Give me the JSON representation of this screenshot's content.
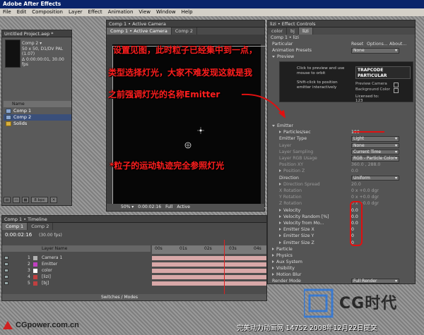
{
  "window": {
    "title": "Adobe After Effects"
  },
  "menu": [
    "File",
    "Edit",
    "Composition",
    "Layer",
    "Effect",
    "Animation",
    "View",
    "Window",
    "Help"
  ],
  "project": {
    "title": "Untitled Project.aep *",
    "thumb_name": "Comp 2 ▾",
    "info": [
      "50 x 50, D1/DV PAL (1.07)",
      "Δ 0:00:00:01, 30.00 fps"
    ],
    "col_name": "Name",
    "items": [
      {
        "name": "Comp 1",
        "type": "comp"
      },
      {
        "name": "Comp 2",
        "type": "comp"
      },
      {
        "name": "Solids",
        "type": "folder"
      }
    ],
    "bpc": "8 bpc"
  },
  "viewer": {
    "title": "Comp 1 • Active Camera",
    "tabs": [
      "Comp 1 • Active Camera",
      "Comp 2"
    ],
    "zoom": "50% ▾",
    "time": "0:00:02:16",
    "res": "Full",
    "view": "Active"
  },
  "effects": {
    "title": "lizi • Effect Controls",
    "tabs": [
      "color",
      "bj",
      "lizi"
    ],
    "breadcrumb": "Comp 1 • lizi",
    "effect_name": "Particular",
    "reset": "Reset",
    "options": "Options...",
    "about": "About...",
    "presets_label": "Animation Presets",
    "presets_value": "None",
    "preview_label": "Preview",
    "preview_hint1": "Click to preview and use mouse to orbit",
    "preview_hint2": "Shift-click to position emitter interactively",
    "logo": "TRAPCODE PARTICULAR",
    "preview_camera": "Preview Camera",
    "background_color": "Background Color",
    "licensed_to": "Licensed to:",
    "license_num": "123",
    "rows": [
      {
        "label": "Emitter",
        "value": "",
        "indent": 0,
        "tri": "open",
        "dim": false
      },
      {
        "label": "Particles/sec",
        "value": "100",
        "indent": 1,
        "tri": "closed",
        "dim": false
      },
      {
        "label": "Emitter Type",
        "value": "Light",
        "indent": 1,
        "tri": "",
        "dim": false,
        "dropdown": true
      },
      {
        "label": "Layer",
        "value": "None",
        "indent": 1,
        "tri": "",
        "dim": true,
        "dropdown": true
      },
      {
        "label": "Layer Sampling",
        "value": "Current Time",
        "indent": 1,
        "tri": "",
        "dim": true,
        "dropdown": true
      },
      {
        "label": "Layer RGB Usage",
        "value": "RGB - Particle Color",
        "indent": 1,
        "tri": "",
        "dim": true,
        "dropdown": true
      },
      {
        "label": "Position XY",
        "value": "360.0 , 288.0",
        "indent": 1,
        "tri": "",
        "dim": true
      },
      {
        "label": "Position Z",
        "value": "0.0",
        "indent": 1,
        "tri": "closed",
        "dim": true
      },
      {
        "label": "Direction",
        "value": "Uniform",
        "indent": 1,
        "tri": "",
        "dim": false,
        "dropdown": true
      },
      {
        "label": "Direction Spread",
        "value": "20.0",
        "indent": 1,
        "tri": "closed",
        "dim": true
      },
      {
        "label": "X Rotation",
        "value": "0 x +0.0 dgr",
        "indent": 1,
        "tri": "",
        "dim": true
      },
      {
        "label": "Y Rotation",
        "value": "0 x +0.0 dgr",
        "indent": 1,
        "tri": "",
        "dim": true
      },
      {
        "label": "Z Rotation",
        "value": "0 x +0.0 dgr",
        "indent": 1,
        "tri": "",
        "dim": true
      },
      {
        "label": "Velocity",
        "value": "0.0",
        "indent": 1,
        "tri": "closed",
        "dim": false
      },
      {
        "label": "Velocity Random [%]",
        "value": "0.0",
        "indent": 1,
        "tri": "closed",
        "dim": false
      },
      {
        "label": "Velocity from Mo...",
        "value": "0.0",
        "indent": 1,
        "tri": "closed",
        "dim": false
      },
      {
        "label": "Emitter Size X",
        "value": "0",
        "indent": 1,
        "tri": "closed",
        "dim": false
      },
      {
        "label": "Emitter Size Y",
        "value": "0",
        "indent": 1,
        "tri": "closed",
        "dim": false
      },
      {
        "label": "Emitter Size Z",
        "value": "0",
        "indent": 1,
        "tri": "closed",
        "dim": false
      },
      {
        "label": "Particle",
        "value": "",
        "indent": 0,
        "tri": "closed",
        "dim": false
      },
      {
        "label": "Physics",
        "value": "",
        "indent": 0,
        "tri": "closed",
        "dim": false
      },
      {
        "label": "Aux System",
        "value": "",
        "indent": 0,
        "tri": "closed",
        "dim": false
      },
      {
        "label": "Visibility",
        "value": "",
        "indent": 0,
        "tri": "closed",
        "dim": false
      },
      {
        "label": "Motion Blur",
        "value": "",
        "indent": 0,
        "tri": "closed",
        "dim": false
      },
      {
        "label": "Render Mode",
        "value": "Full Render",
        "indent": 0,
        "tri": "",
        "dim": false,
        "dropdown": true
      }
    ]
  },
  "timeline": {
    "title": "Comp 1 • Timeline",
    "tabs": [
      "Comp 1",
      "Comp 2"
    ],
    "time": "0:00:02:16",
    "fps": "(30.00 fps)",
    "col_layer": "Layer Name",
    "ruler": [
      "00s",
      "01s",
      "02s",
      "03s",
      "04s"
    ],
    "footer": "Switches / Modes",
    "layers": [
      {
        "num": "1",
        "name": "Camera 1",
        "color": "#b0b0b0"
      },
      {
        "num": "2",
        "name": "Emitter",
        "color": "#c040c0"
      },
      {
        "num": "3",
        "name": "color",
        "color": "#ffffff"
      },
      {
        "num": "4",
        "name": "[lizi]",
        "color": "#c04040"
      },
      {
        "num": "5",
        "name": "[bj]",
        "color": "#c04040"
      }
    ]
  },
  "notes": [
    "设置见图，此时粒子已经集中到一点，",
    "类型选择灯光，大家不难发现这就是我",
    "之前强调灯光的名称Emitter",
    "*粒子的运动轨迹完全参照灯光"
  ],
  "footer": {
    "site": "CGpower.com.cn",
    "credit": "完美动力动画网 14752 2008年12月22日提交",
    "cg_logo": "CG时代"
  },
  "colors": {
    "note": "#ff1e1e",
    "title_bar": "#0a246a"
  }
}
